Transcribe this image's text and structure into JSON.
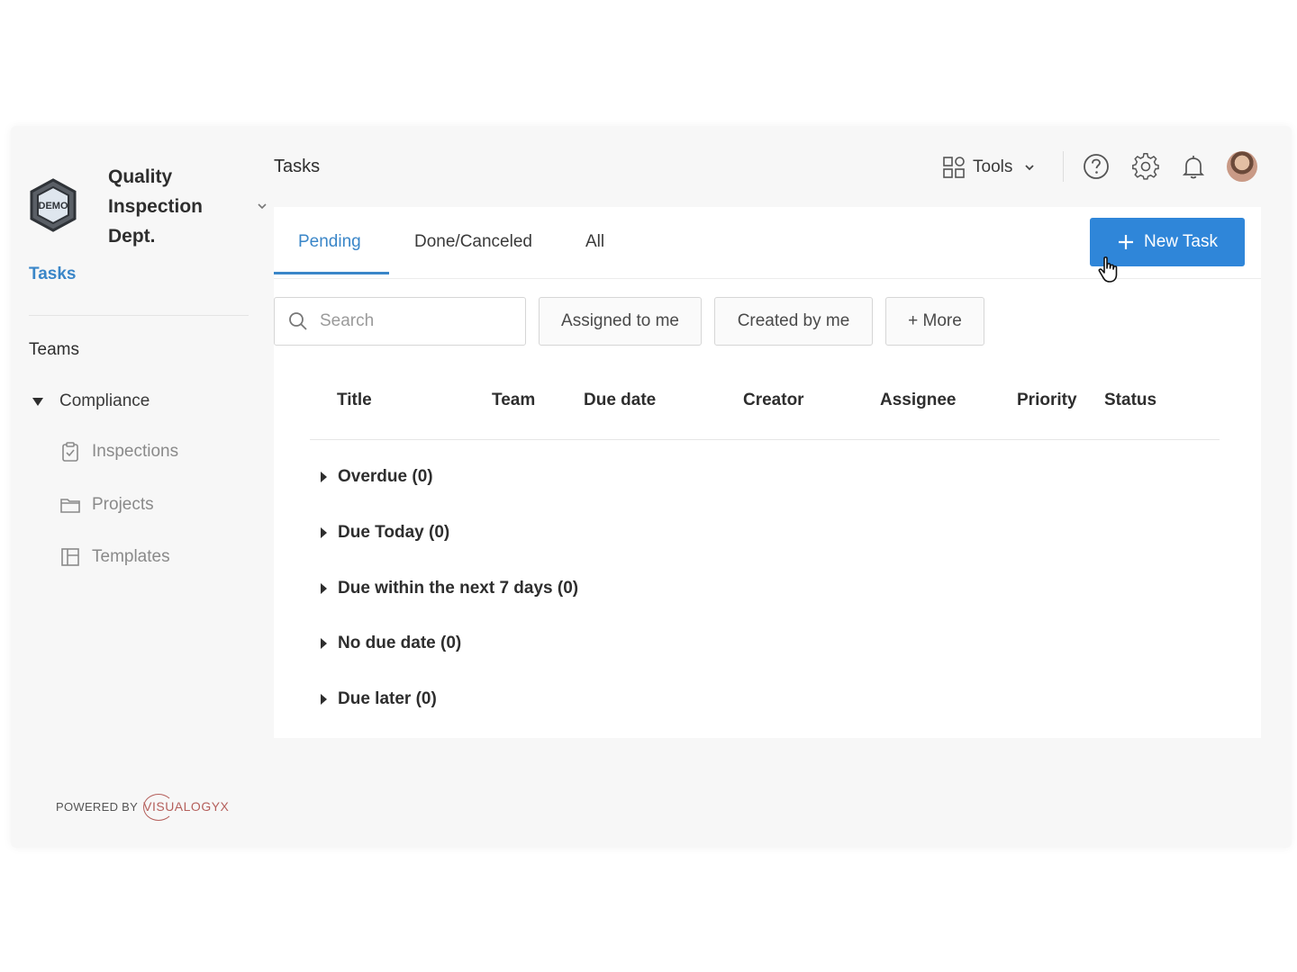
{
  "org": {
    "name_lines": [
      "Quality",
      "Inspection",
      "Dept."
    ],
    "logo_text": "DEMO"
  },
  "sidebar": {
    "tasks_label": "Tasks",
    "teams_label": "Teams",
    "team": {
      "name": "Compliance",
      "items": [
        {
          "label": "Inspections",
          "icon": "clipboard-check-icon"
        },
        {
          "label": "Projects",
          "icon": "folder-icon"
        },
        {
          "label": "Templates",
          "icon": "template-icon"
        }
      ]
    },
    "powered_by": "POWERED BY",
    "brand": "VISUALOGYX"
  },
  "header": {
    "title": "Tasks",
    "tools_label": "Tools"
  },
  "tabs": [
    {
      "label": "Pending",
      "active": true
    },
    {
      "label": "Done/Canceled",
      "active": false
    },
    {
      "label": "All",
      "active": false
    }
  ],
  "new_task_label": "New Task",
  "filters": {
    "search_placeholder": "Search",
    "buttons": [
      "Assigned to me",
      "Created by me",
      "+ More"
    ]
  },
  "table": {
    "columns": [
      "Title",
      "Team",
      "Due date",
      "Creator",
      "Assignee",
      "Priority",
      "Status"
    ],
    "groups": [
      "Overdue (0)",
      "Due Today (0)",
      "Due within the next 7 days (0)",
      "No due date (0)",
      "Due later (0)"
    ]
  },
  "colors": {
    "accent": "#3a86c8",
    "primary_button": "#2f86d9",
    "brand": "#b5605c"
  }
}
